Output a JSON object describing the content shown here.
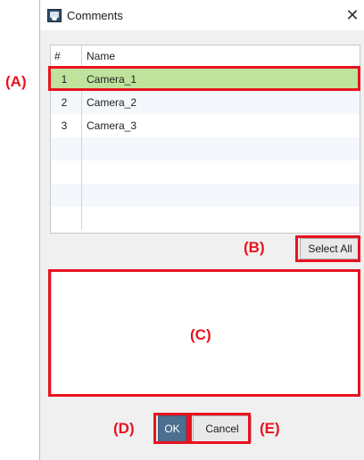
{
  "dialog": {
    "title": "Comments",
    "close_glyph": "✕"
  },
  "grid": {
    "columns": [
      "#",
      "Name"
    ],
    "rows": [
      {
        "num": "1",
        "name": "Camera_1",
        "selected": true
      },
      {
        "num": "2",
        "name": "Camera_2",
        "selected": false
      },
      {
        "num": "3",
        "name": "Camera_3",
        "selected": false
      }
    ],
    "empty_rows": 4,
    "selected_color": "#bfe29d"
  },
  "buttons": {
    "select_all": "Select All",
    "ok": "OK",
    "cancel": "Cancel",
    "ok_color": "#4c6e8f"
  },
  "comment_box": {
    "value": ""
  },
  "annotations": {
    "color": "#e8131f",
    "a": "(A)",
    "b": "(B)",
    "c": "(C)",
    "d": "(D)",
    "e": "(E)"
  },
  "icons": {
    "app": "camera-app-icon",
    "close": "close-icon"
  }
}
